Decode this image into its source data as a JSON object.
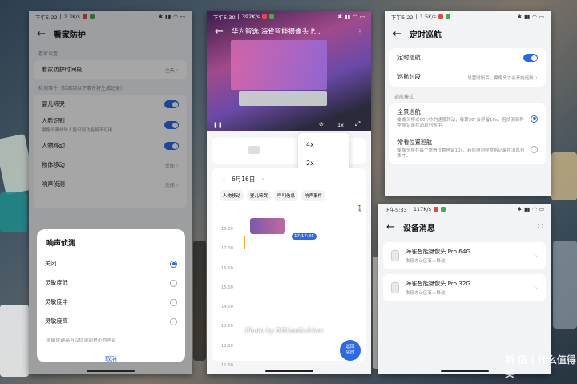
{
  "colors": {
    "accent": "#2a6ae8",
    "toggle_on": "#2a6ae8"
  },
  "phone1": {
    "status": {
      "time": "下午5:22",
      "speed": "2.3K/s"
    },
    "title": "看家防护",
    "section1": "看家设置",
    "schedule_label": "看家防护时间段",
    "schedule_value": "全天",
    "section2": "检测事件（检测到以下事件将生成记录）",
    "events": [
      {
        "label": "婴儿啼哭",
        "sub": ""
      },
      {
        "label": "人脸识别",
        "sub": "摄像头离线时人脸识别功能将不可用"
      },
      {
        "label": "人物移动",
        "sub": ""
      }
    ],
    "rows": [
      {
        "label": "物体移动",
        "value": "关闭"
      },
      {
        "label": "响声侦测",
        "value": "关闭"
      }
    ],
    "sheet": {
      "title": "响声侦测",
      "options": [
        "关闭",
        "灵敏度低",
        "灵敏度中",
        "灵敏度高"
      ],
      "selected": 0,
      "hint": "灵敏度越高可以侦测到更小的声音",
      "cancel": "取消"
    }
  },
  "phone2": {
    "status": {
      "time": "下午5:30",
      "speed": "392K/s"
    },
    "title": "华为智选 海雀智能摄像头 P...",
    "speed_menu": [
      "4x",
      "2x",
      "1x"
    ],
    "speed_selected": 2,
    "speed_button": "1x",
    "date": "6月16日",
    "filters": [
      "人物移动",
      "婴儿啼哭",
      "呼叫信息",
      "响声事件"
    ],
    "timeline_hours": [
      "18:00",
      "17:00",
      "16:00",
      "15:00",
      "14:00",
      "13:00",
      "12:00",
      "11:00"
    ],
    "current_time": "17:17:36",
    "fab": "返回\n实时",
    "watermark": "Photo by BIDianXu10an"
  },
  "phone3": {
    "status": {
      "time": "下午5:22",
      "speed": "1.5K/s"
    },
    "title": "定时巡航",
    "cruise_label": "定时巡航",
    "period_label": "巡航时段",
    "period_hint": "设置时段后，摄像头才会开始巡航",
    "mode_section": "巡航模式",
    "modes": [
      {
        "label": "全景巡航",
        "desc": "摄像头将以60°/秒的速度转动，每转36°会停留10s，若侦测到异常将记录在消息列表中。"
      },
      {
        "label": "常看位置巡航",
        "desc": "摄像头将在每个常看位置停留10s，若侦测到异常将记录在消息列表中。"
      }
    ],
    "mode_selected": 0
  },
  "phone4": {
    "status": {
      "time": "下午5:33",
      "speed": "117K/s"
    },
    "title": "设备消息",
    "messages": [
      {
        "title": "海雀智能摄像头 Pro 64G",
        "sub": "发现办公区有人移动"
      },
      {
        "title": "海雀智能摄像头 Pro 32G",
        "sub": "发现办公区有人移动"
      }
    ]
  },
  "brand_watermark": "新 值 | 什么值得买"
}
